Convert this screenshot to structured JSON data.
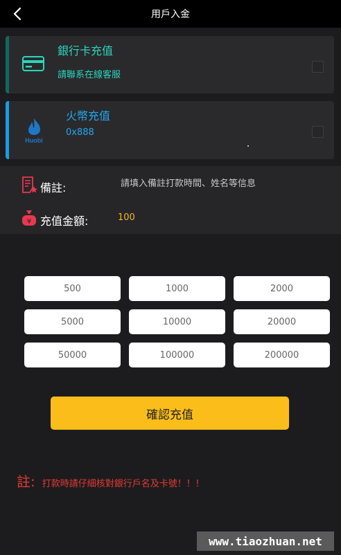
{
  "header": {
    "title": "用戶入金",
    "back_icon": "chevron-left-icon"
  },
  "payment_methods": [
    {
      "name": "銀行卡充值",
      "detail": "請聯系在線客服",
      "icon": "credit-card-icon",
      "accent": "#2bd6bd"
    },
    {
      "name": "火幣充值",
      "detail": "0x888",
      "icon": "huobi-logo",
      "logo_text": "Huobi",
      "accent": "#22a9f0"
    }
  ],
  "form": {
    "note_label": "備註:",
    "note_placeholder": "請填入備註打款時間、姓名等信息",
    "amount_label": "充值金額:",
    "amount_value": "100"
  },
  "amounts": [
    "500",
    "1000",
    "2000",
    "5000",
    "10000",
    "20000",
    "50000",
    "100000",
    "200000"
  ],
  "confirm_label": "確認充值",
  "notice": {
    "label": "註:",
    "text": "打款時請仔細核對銀行戶名及卡號！！！"
  },
  "watermark": "www.tiaozhuan.net",
  "colors": {
    "confirm": "#fbbd1a",
    "warning": "#e53935",
    "bank_accent": "#2bd6bd",
    "huobi_accent": "#22a9f0"
  }
}
